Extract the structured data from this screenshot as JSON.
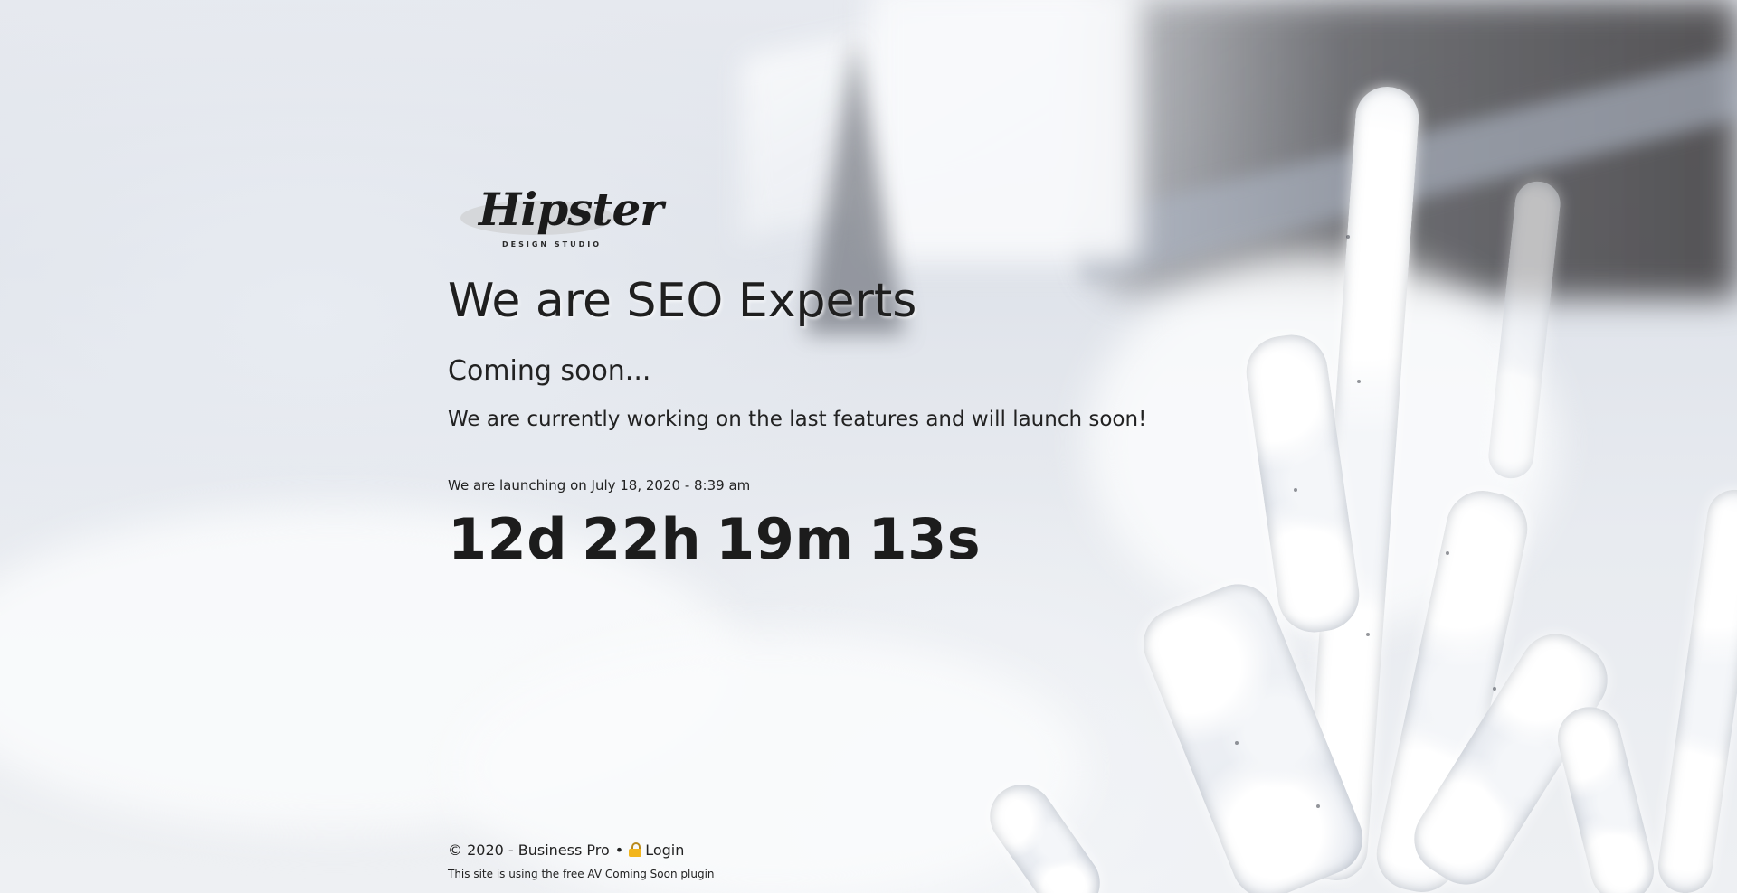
{
  "logo": {
    "wordmark": "Hipster",
    "tagline": "DESIGN STUDIO"
  },
  "main": {
    "headline": "We are SEO Experts",
    "subheadline": "Coming soon...",
    "message": "We are currently working on the last features and will launch soon!",
    "launch_note": "We are launching on July 18, 2020 - 8:39 am",
    "countdown": {
      "days": "12d",
      "hours": "22h",
      "minutes": "19m",
      "seconds": "13s"
    }
  },
  "footer": {
    "copyright": "© 2020 - Business Pro",
    "separator": "•",
    "login_icon": "lock-icon",
    "login_label": "Login",
    "credit": "This site is using the free AV Coming Soon plugin"
  },
  "colors": {
    "text": "#1e1e1e",
    "lock": "#f2b51d"
  }
}
